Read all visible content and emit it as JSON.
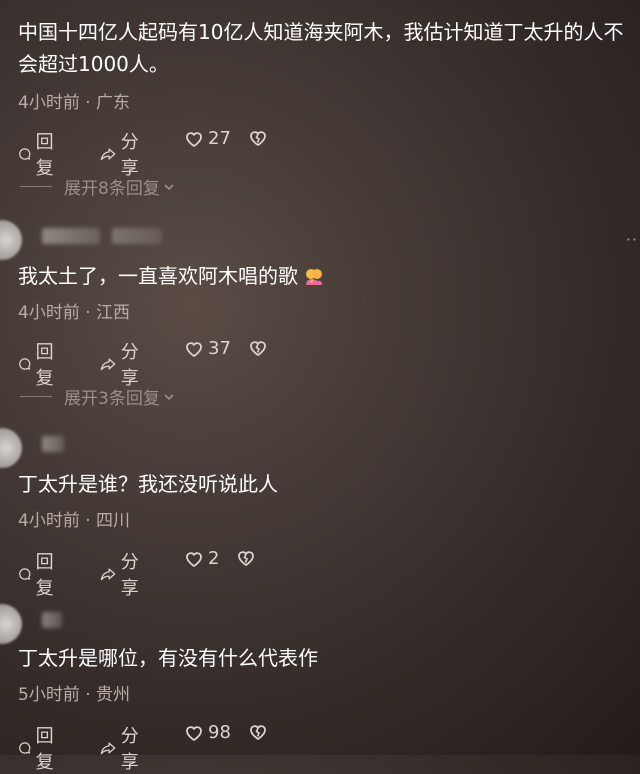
{
  "comments": [
    {
      "text": "中国十四亿人起码有10亿人知道海夹阿木，我估计知道丁太升的人不会超过1000人。",
      "meta": "4小时前 · 广东",
      "reply_label": "回复",
      "share_label": "分享",
      "likes": "27",
      "expand_label": "展开8条回复"
    },
    {
      "text": "我太土了，一直喜欢阿木唱的歌",
      "meta": "4小时前 · 江西",
      "reply_label": "回复",
      "share_label": "分享",
      "likes": "37",
      "expand_label": "展开3条回复"
    },
    {
      "text": "丁太升是谁？我还没听说此人",
      "meta": "4小时前 · 四川",
      "reply_label": "回复",
      "share_label": "分享",
      "likes": "2"
    },
    {
      "text": "丁太升是哪位，有没有什么代表作",
      "meta": "5小时前 · 贵州",
      "reply_label": "回复",
      "share_label": "分享",
      "likes": "98"
    }
  ],
  "icons": {
    "reply": "speech-bubble-icon",
    "share": "share-arrow-icon",
    "like": "heart-icon",
    "dislike": "broken-heart-icon",
    "expand": "chevron-down-icon",
    "more": "more-dots-icon"
  },
  "colors": {
    "text": "#ffffff",
    "meta": "#b9aca7",
    "actions": "#ddd3cf"
  }
}
